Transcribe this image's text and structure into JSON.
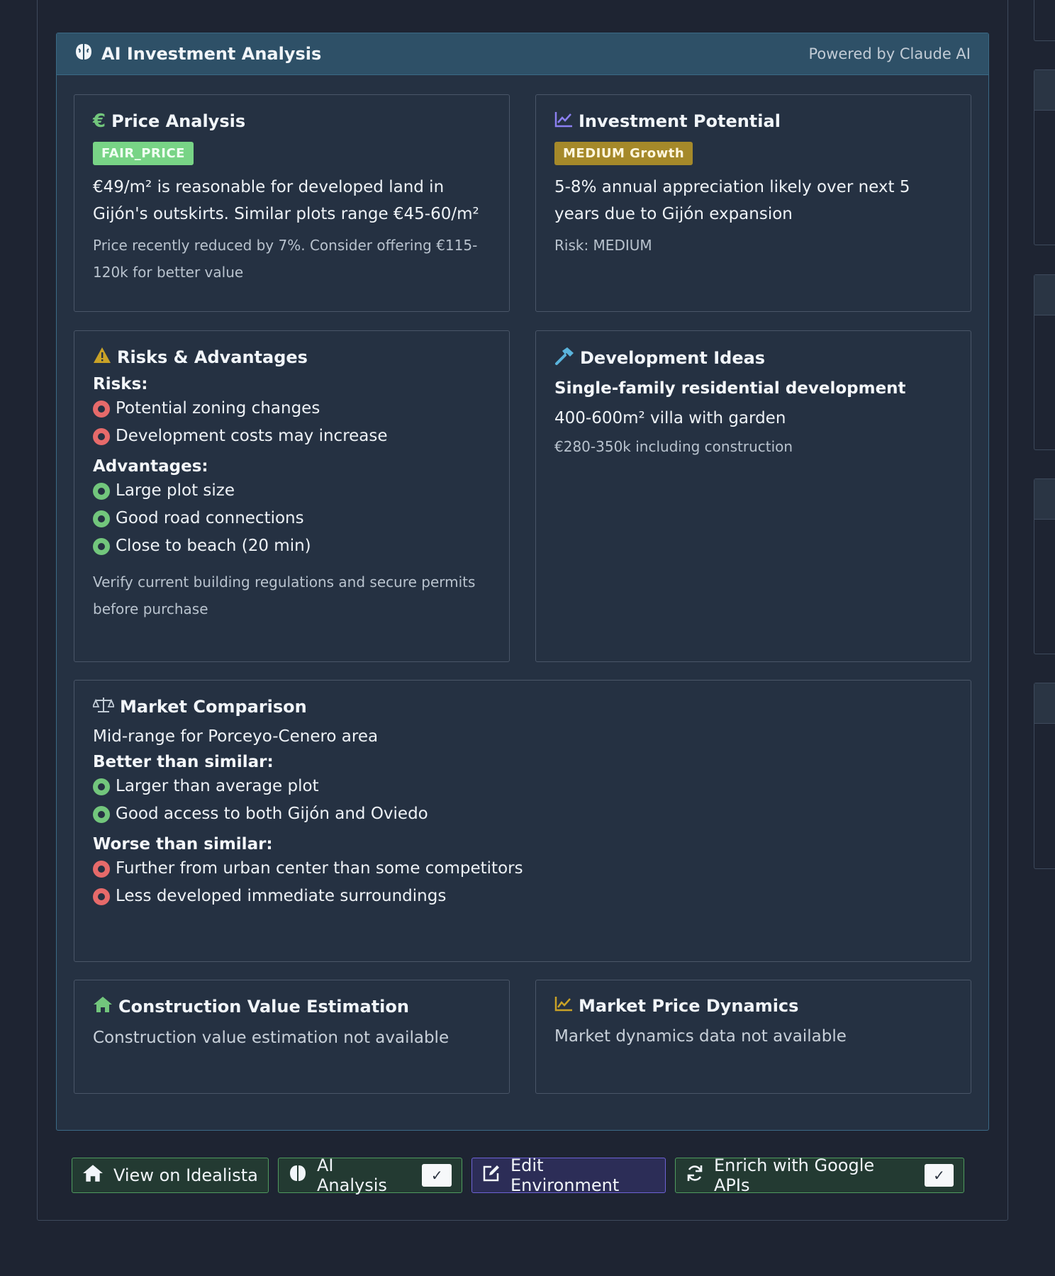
{
  "panel": {
    "title": "AI Investment Analysis",
    "powered_by": "Powered by Claude AI"
  },
  "price_analysis": {
    "title": "Price Analysis",
    "badge": "FAIR_PRICE",
    "text": "€49/m² is reasonable for developed land in Gijón's outskirts. Similar plots range €45-60/m²",
    "note": "Price recently reduced by 7%. Consider offering €115-120k for better value"
  },
  "investment_potential": {
    "title": "Investment Potential",
    "badge": "MEDIUM Growth",
    "text": "5-8% annual appreciation likely over next 5 years due to Gijón expansion",
    "risk": "Risk: MEDIUM"
  },
  "risks_advantages": {
    "title": "Risks & Advantages",
    "risks_heading": "Risks:",
    "risks": [
      "Potential zoning changes",
      "Development costs may increase"
    ],
    "advantages_heading": "Advantages:",
    "advantages": [
      "Large plot size",
      "Good road connections",
      "Close to beach (20 min)"
    ],
    "note": "Verify current building regulations and secure permits before purchase"
  },
  "development_ideas": {
    "title": "Development Ideas",
    "headline": "Single-family residential development",
    "text": "400-600m² villa with garden",
    "cost": "€280-350k including construction"
  },
  "market_comparison": {
    "title": "Market Comparison",
    "summary": "Mid-range for Porceyo-Cenero area",
    "better_heading": "Better than similar:",
    "better": [
      "Larger than average plot",
      "Good access to both Gijón and Oviedo"
    ],
    "worse_heading": "Worse than similar:",
    "worse": [
      "Further from urban center than some competitors",
      "Less developed immediate surroundings"
    ]
  },
  "construction_value": {
    "title": "Construction Value Estimation",
    "text": "Construction value estimation not available"
  },
  "market_dynamics": {
    "title": "Market Price Dynamics",
    "text": "Market dynamics data not available"
  },
  "buttons": {
    "idealista": "View on Idealista",
    "ai_analysis": "AI Analysis",
    "edit_env": "Edit Environment",
    "enrich": "Enrich with Google APIs",
    "check": "✓"
  },
  "icons": {
    "panel": "brain-icon",
    "price": "euro-icon",
    "investment": "chart-line-icon",
    "risks": "warning-icon",
    "development": "hammer-icon",
    "market": "scale-icon",
    "construction": "home-icon",
    "dynamics": "chart-area-icon",
    "refresh": "refresh-icon",
    "edit": "edit-icon"
  },
  "colors": {
    "fair_price_badge": "#78d486",
    "medium_badge": "#a5892a",
    "risk_dot": "#e66a6a",
    "advantage_dot": "#72c67c",
    "panel_header": "#2e5067"
  }
}
